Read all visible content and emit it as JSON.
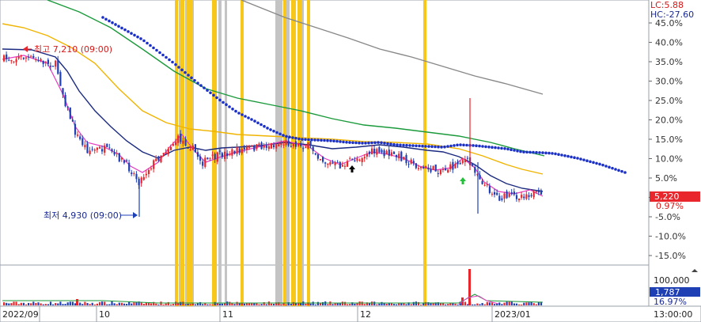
{
  "legend": {
    "lc": "LC:5.88",
    "hc": "HC:-27.60"
  },
  "price_axis": {
    "ticks": [
      "45.0%",
      "40.0%",
      "35.0%",
      "30.0%",
      "25.0%",
      "20.0%",
      "15.0%",
      "10.0%",
      "5.0%",
      "0.0%",
      "-5.0%",
      "-10.0%",
      "-15.0%"
    ],
    "current_price": "5,220",
    "current_change": "0.97%"
  },
  "volume_axis": {
    "max": "100,000",
    "current": "1,787",
    "pct": "16.97%"
  },
  "annotations": {
    "high": "최고 7,210 (09:00)",
    "low": "최저 4,930 (09:00)"
  },
  "time_axis": {
    "labels": [
      "2022/09",
      "10",
      "11",
      "12",
      "2023/01"
    ],
    "time": "13:00:00"
  },
  "colors": {
    "up": "#e8262b",
    "down": "#1f3fb4",
    "ma5": "#e63cc0",
    "ma20": "#1a2a80",
    "ma60": "#f0b400",
    "ma120": "#1a9a3a",
    "ma240": "#888888",
    "dots": "#1a30c8",
    "highlight_yellow": "#f7c71c",
    "highlight_gray": "#c4c4c4"
  }
}
